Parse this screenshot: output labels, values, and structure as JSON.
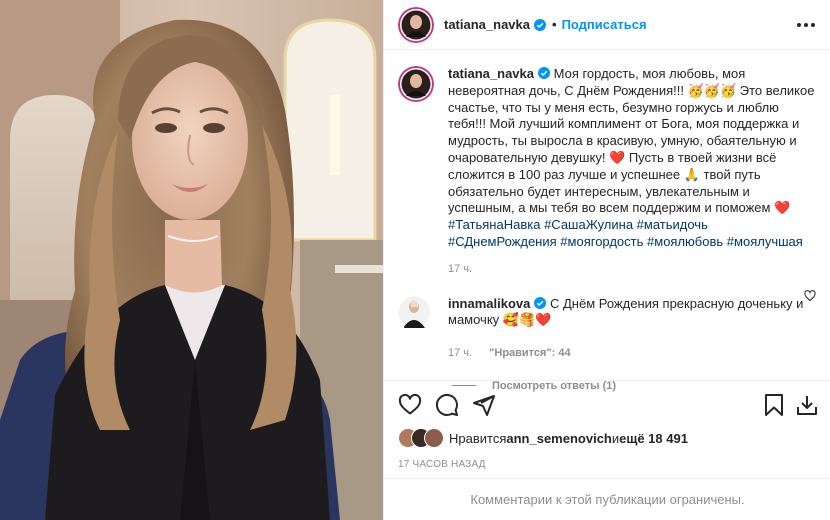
{
  "colors": {
    "accent": "#0095f6",
    "text": "#262626",
    "muted": "#8e8e8e",
    "hashtag": "#00376b",
    "heart": "#ed4956"
  },
  "header": {
    "username": "tatiana_navka",
    "dot": "•",
    "follow_label": "Подписаться",
    "more_icon": "more-horizontal-icon"
  },
  "caption": {
    "username": "tatiana_navka",
    "text_1": " Моя гордость, моя любовь, моя невероятная дочь, С Днём Рождения!!! 🥳🥳🥳 Это великое счастье, что ты у меня есть, безумно горжусь и люблю тебя!!! Мой лучший комплимент от Бога, моя поддержка и мудрость, ты выросла в красивую, умную, обаятельную и очаровательную девушку! ❤️ Пусть в твоей жизни всё сложится в 100 раз лучше и успешнее 🙏 твой путь обязательно будет интересным, увлекательным и успешным, а мы тебя во всем поддержим и поможем ❤️ ",
    "hashtags": [
      "#ТатьянаНавка",
      "#СашаЖулина",
      "#матьидочь",
      "#СДнемРождения",
      "#моягордость",
      "#моялюбовь",
      "#моялучшая"
    ],
    "time": "17 ч."
  },
  "comment": {
    "username": "innamalikova",
    "text": " С Днём Рождения прекрасную доченьку и мамочку 🥰🥞❤️",
    "time": "17 ч.",
    "likes": "\"Нравится\": 44",
    "view_replies": "Посмотреть ответы (1)"
  },
  "actions": {
    "like_icon": "heart-icon",
    "comment_icon": "comment-icon",
    "share_icon": "send-icon",
    "save_icon": "bookmark-icon",
    "download_icon": "download-icon"
  },
  "likes": {
    "prefix": "Нравится ",
    "user": "ann_semenovich",
    "middle": " и ",
    "more": "ещё 18 491"
  },
  "timestamp": "17 ЧАСОВ НАЗАД",
  "restricted": "Комментарии к этой публикации ограничены."
}
